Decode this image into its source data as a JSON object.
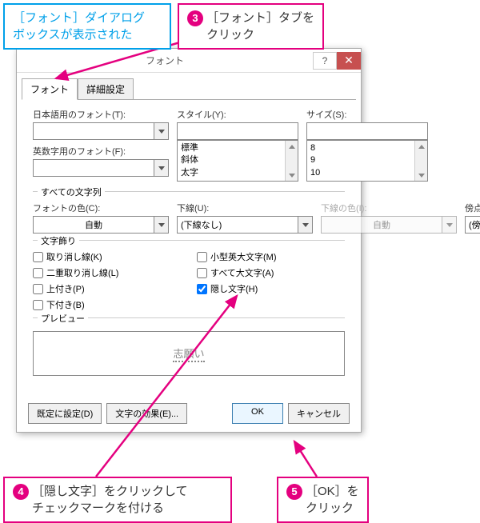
{
  "callouts": {
    "info": "［フォント］ダイアログ\nボックスが表示された",
    "step3": "［フォント］タブを\nクリック",
    "step4": "［隠し文字］をクリックして\nチェックマークを付ける",
    "step5": "［OK］を\nクリック",
    "n3": "3",
    "n4": "4",
    "n5": "5"
  },
  "dialog": {
    "title": "フォント",
    "help": "?",
    "close": "✕",
    "tabs": {
      "font": "フォント",
      "adv": "詳細設定"
    },
    "labels": {
      "jpfont": "日本語用のフォント(T):",
      "enfont": "英数字用のフォント(F):",
      "style": "スタイル(Y):",
      "size": "サイズ(S):",
      "allchars": "すべての文字列",
      "fontcolor": "フォントの色(C):",
      "underline": "下線(U):",
      "ulcolor": "下線の色(I):",
      "emphasis": "傍点(:)",
      "decor": "文字飾り",
      "preview": "プレビュー"
    },
    "values": {
      "fontcolor": "自動",
      "underline": "(下線なし)",
      "ulcolor": "自動",
      "emphasis": "(傍点なし)",
      "style_list": "標準\n斜体\n太字",
      "size_list": "8\n9\n10",
      "preview_text": "志願い"
    },
    "checks": {
      "strike": "取り消し線(K)",
      "dstrike": "二重取り消し線(L)",
      "super": "上付き(P)",
      "sub": "下付き(B)",
      "smallcaps": "小型英大文字(M)",
      "allcaps": "すべて大文字(A)",
      "hidden": "隠し文字(H)"
    },
    "buttons": {
      "default": "既定に設定(D)",
      "effects": "文字の効果(E)...",
      "ok": "OK",
      "cancel": "キャンセル"
    }
  }
}
